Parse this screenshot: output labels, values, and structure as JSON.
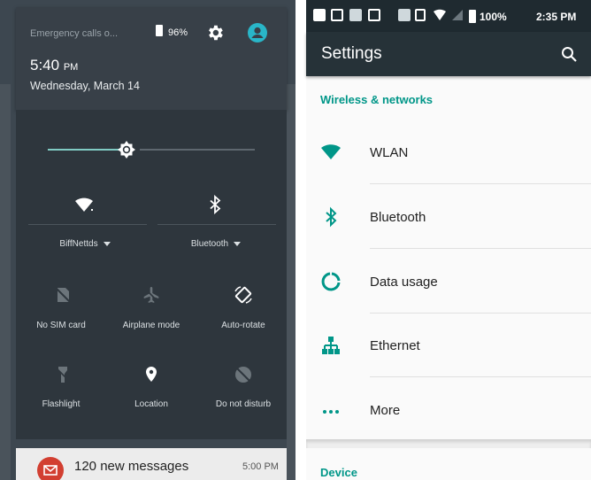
{
  "quick_settings": {
    "emergency": "Emergency calls o...",
    "battery": "96%",
    "time_main": "5:40",
    "time_suffix": "PM",
    "date": "Wednesday, March 14",
    "tiles": {
      "wifi": "BiffNettds",
      "bluetooth": "Bluetooth",
      "sim": "No SIM card",
      "airplane": "Airplane mode",
      "autorotate": "Auto-rotate",
      "flashlight": "Flashlight",
      "location": "Location",
      "dnd": "Do not disturb"
    }
  },
  "notification": {
    "title": "120 new messages",
    "time": "5:00 PM"
  },
  "settings": {
    "status_battery": "100%",
    "status_time": "2:35 PM",
    "title": "Settings",
    "section_wireless": "Wireless & networks",
    "items": [
      "WLAN",
      "Bluetooth",
      "Data usage",
      "Ethernet",
      "More"
    ],
    "section_device": "Device"
  },
  "colors": {
    "accent": "#009688",
    "panel": "#2e363d",
    "appbar": "#263238"
  }
}
